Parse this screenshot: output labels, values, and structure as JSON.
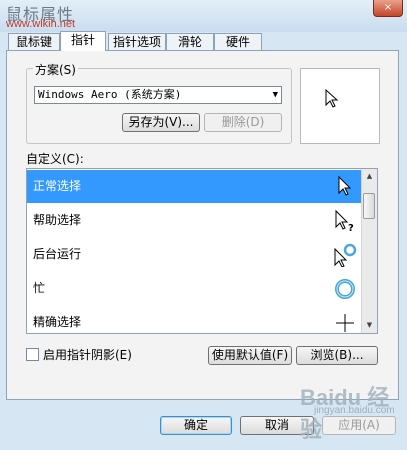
{
  "window": {
    "title": "鼠标属性",
    "site_mark": "www.wikih.net",
    "close_symbol": "×"
  },
  "tabs": [
    {
      "label": "鼠标键"
    },
    {
      "label": "指针",
      "active": true
    },
    {
      "label": "指针选项"
    },
    {
      "label": "滑轮"
    },
    {
      "label": "硬件"
    }
  ],
  "scheme": {
    "group_label": "方案(S)",
    "selected": "Windows Aero (系统方案)",
    "save_as_button": "另存为(V)...",
    "delete_button": "删除(D)"
  },
  "customize": {
    "label": "自定义(C):",
    "items": [
      {
        "label": "正常选择",
        "icon": "arrow-cursor-icon",
        "selected": true
      },
      {
        "label": "帮助选择",
        "icon": "help-select-cursor-icon"
      },
      {
        "label": "后台运行",
        "icon": "working-in-background-cursor-icon"
      },
      {
        "label": "忙",
        "icon": "busy-cursor-icon"
      },
      {
        "label": "精确选择",
        "icon": "precision-select-cursor-icon"
      }
    ]
  },
  "options": {
    "shadow_checkbox": "启用指针阴影(E)",
    "shadow_checked": false,
    "use_default_button": "使用默认值(F)",
    "browse_button": "浏览(B)..."
  },
  "footer": {
    "ok": "确定",
    "cancel": "取消",
    "apply": "应用(A)"
  },
  "watermark": {
    "brand": "Baidu 经验",
    "url": "jingyan.baidu.com"
  },
  "colors": {
    "selection": "#3399ff",
    "window_bg": "#d6e6f3"
  }
}
